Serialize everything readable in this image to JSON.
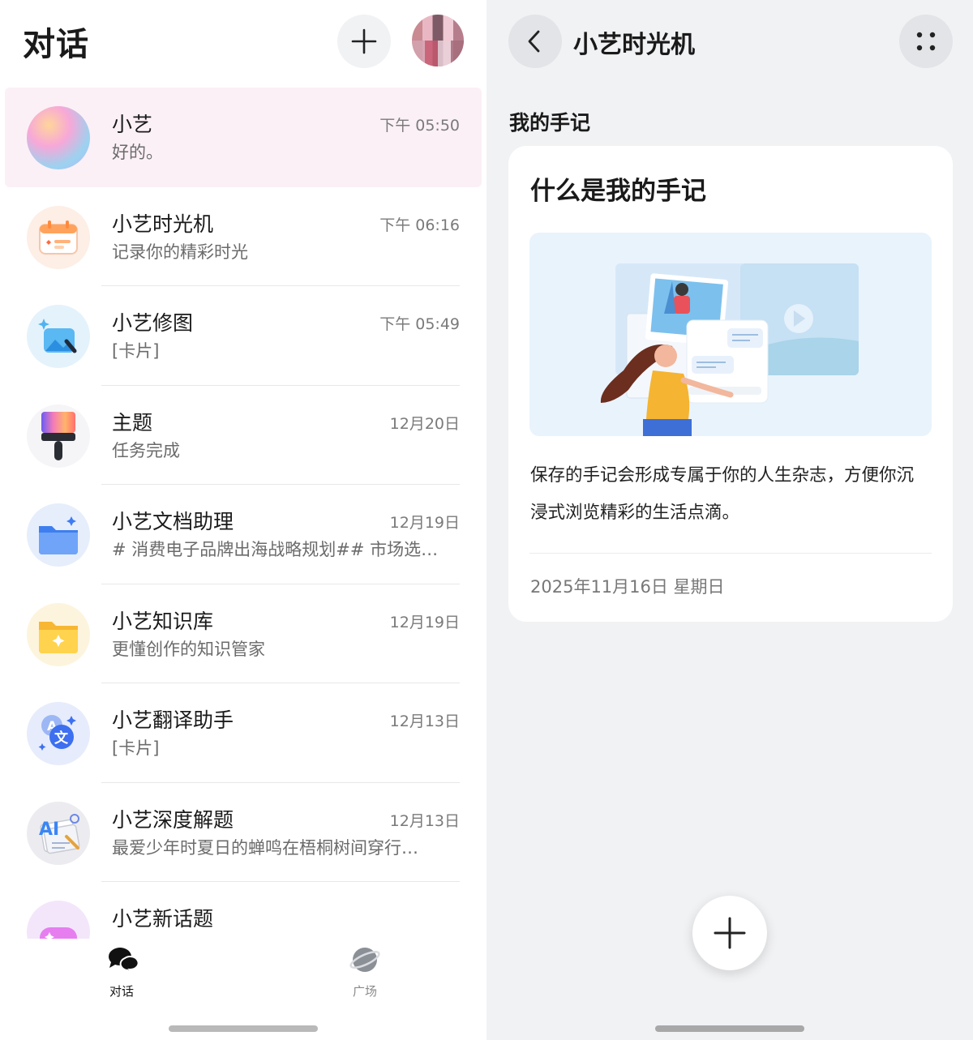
{
  "left": {
    "title": "对话",
    "conversations": [
      {
        "name": "小艺",
        "sub": "好的。",
        "time": "下午 05:50",
        "icon": "xiaoyi-orb-icon"
      },
      {
        "name": "小艺时光机",
        "sub": "记录你的精彩时光",
        "time": "下午 06:16",
        "icon": "time-machine-calendar-icon"
      },
      {
        "name": "小艺修图",
        "sub": "[卡片]",
        "time": "下午 05:49",
        "icon": "photo-edit-icon"
      },
      {
        "name": "主题",
        "sub": "任务完成",
        "time": "12月20日",
        "icon": "paint-brush-icon"
      },
      {
        "name": "小艺文档助理",
        "sub": "# 消费电子品牌出海战略规划## 市场选…",
        "time": "12月19日",
        "icon": "folder-icon"
      },
      {
        "name": "小艺知识库",
        "sub": "更懂创作的知识管家",
        "time": "12月19日",
        "icon": "knowledge-folder-icon"
      },
      {
        "name": "小艺翻译助手",
        "sub": "[卡片]",
        "time": "12月13日",
        "icon": "translate-icon"
      },
      {
        "name": "小艺深度解题",
        "sub": "最爱少年时夏日的蝉鸣在梧桐树间穿行…",
        "time": "12月13日",
        "icon": "ai-solver-icon"
      },
      {
        "name": "小艺新话题",
        "sub": "",
        "time": "",
        "icon": "new-topic-icon"
      }
    ],
    "nav": {
      "chat_label": "对话",
      "plaza_label": "广场"
    }
  },
  "right": {
    "title": "小艺时光机",
    "section_title": "我的手记",
    "card": {
      "title": "什么是我的手记",
      "description": "保存的手记会形成专属于你的人生杂志，方便你沉浸式浏览精彩的生活点滴。",
      "date": "2025年11月16日 星期日"
    }
  },
  "colors": {
    "active_row_bg": "#fbf0f6",
    "right_bg": "#f1f2f4",
    "button_bg": "#f1f2f4"
  }
}
